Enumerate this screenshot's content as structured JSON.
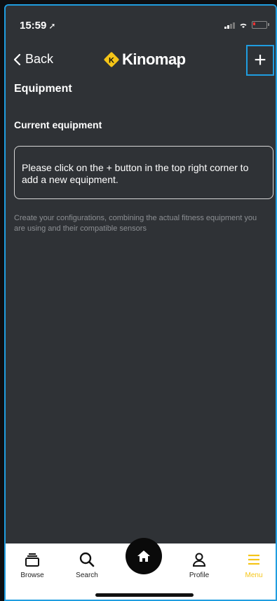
{
  "status_bar": {
    "time": "15:59"
  },
  "nav": {
    "back_label": "Back",
    "app_name": "Kinomap",
    "add_label": "+"
  },
  "page": {
    "title": "Equipment",
    "section_label": "Current equipment",
    "empty_message": "Please click on the + button in the top right corner to add a new equipment.",
    "hint": "Create your configurations, combining the actual fitness equipment you are using and their compatible sensors"
  },
  "tabbar": {
    "items": [
      {
        "label": "Browse",
        "icon": "browse-icon"
      },
      {
        "label": "Search",
        "icon": "search-icon"
      },
      {
        "label": "",
        "icon": "home-icon"
      },
      {
        "label": "Profile",
        "icon": "profile-icon"
      },
      {
        "label": "Menu",
        "icon": "menu-icon"
      }
    ]
  },
  "colors": {
    "background": "#2f3236",
    "accent": "#f5c518",
    "focus_border": "#1f9de0",
    "tabbar": "#ffffff"
  }
}
